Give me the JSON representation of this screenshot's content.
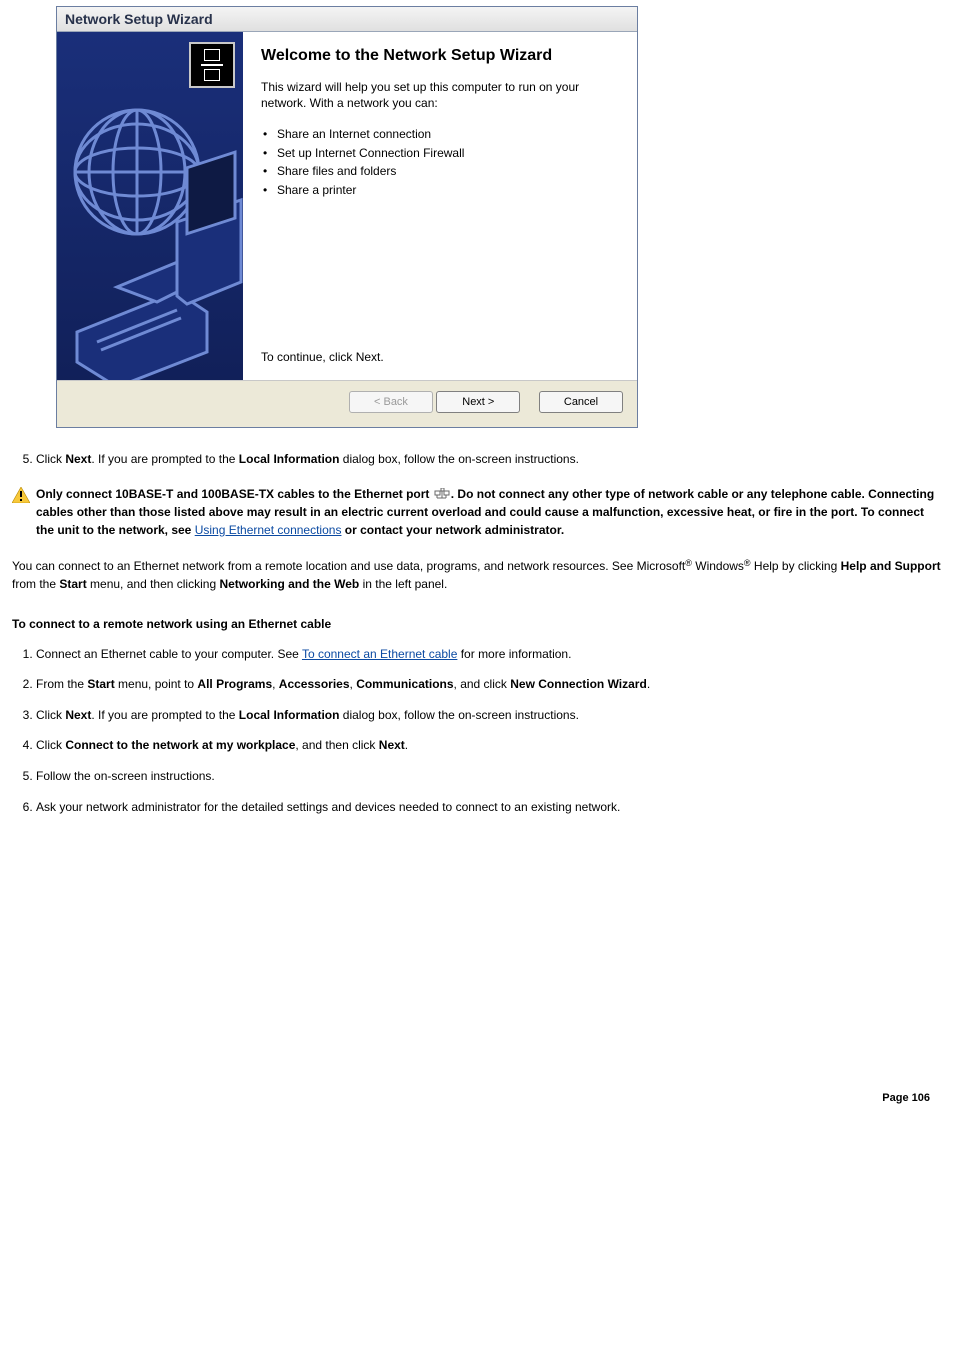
{
  "wizard": {
    "title": "Network Setup Wizard",
    "heading": "Welcome to the Network Setup Wizard",
    "intro": "This wizard will help you set up this computer to run on your network. With a network you can:",
    "bullets": [
      "Share an Internet connection",
      "Set up Internet Connection Firewall",
      "Share files and folders",
      "Share a printer"
    ],
    "continue_text": "To continue, click Next.",
    "back_label": "< Back",
    "next_label": "Next >",
    "cancel_label": "Cancel"
  },
  "step5": {
    "prefix": "Click ",
    "bold1": "Next",
    "mid": ". If you are prompted to the ",
    "bold2": "Local Information",
    "suffix": " dialog box, follow the on-screen instructions."
  },
  "warning": {
    "t1": "Only connect 10BASE-T and 100BASE-TX cables to the Ethernet port ",
    "t2": ". Do not connect any other type of network cable or any telephone cable. Connecting cables other than those listed above may result in an electric current overload and could cause a malfunction, excessive heat, or fire in the port. To connect the unit to the network, see ",
    "link": "Using Ethernet connections",
    "t3": " or contact your network administrator."
  },
  "para1": {
    "t1": "You can connect to an Ethernet network from a remote location and use data, programs, and network resources. See Microsoft",
    "t2": " Windows",
    "t3": " Help by clicking ",
    "b1": "Help and Support",
    "t4": " from the ",
    "b2": "Start",
    "t5": " menu, and then clicking ",
    "b3": "Networking and the Web",
    "t6": " in the left panel."
  },
  "h3": "To connect to a remote network using an Ethernet cable",
  "steps2": {
    "s1a": "Connect an Ethernet cable to your computer. See ",
    "s1link": "To connect an Ethernet cable",
    "s1b": " for more information.",
    "s2a": "From the ",
    "s2b1": "Start",
    "s2b": " menu, point to ",
    "s2b2": "All Programs",
    "s2c": ", ",
    "s2b3": "Accessories",
    "s2d": ", ",
    "s2b4": "Communications",
    "s2e": ", and click ",
    "s2b5": "New Connection Wizard",
    "s2f": ".",
    "s3a": "Click ",
    "s3b1": "Next",
    "s3b": ". If you are prompted to the ",
    "s3b2": "Local Information",
    "s3c": " dialog box, follow the on-screen instructions.",
    "s4a": "Click ",
    "s4b1": "Connect to the network at my workplace",
    "s4b": ", and then click ",
    "s4b2": "Next",
    "s4c": ".",
    "s5": "Follow the on-screen instructions.",
    "s6": "Ask your network administrator for the detailed settings and devices needed to connect to an existing network."
  },
  "page_number": "Page 106"
}
